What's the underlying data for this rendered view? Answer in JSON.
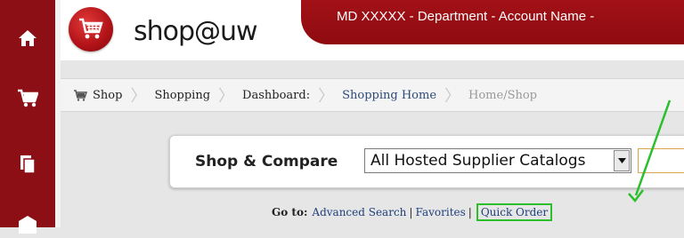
{
  "brand": {
    "logo_text": "shop@uw"
  },
  "account": {
    "banner_text": "MD XXXXX  -  Department  -  Account Name  -"
  },
  "rail": {
    "icons": [
      "home-icon",
      "cart-icon",
      "documents-icon",
      "inbox-icon"
    ]
  },
  "breadcrumb": {
    "items": [
      {
        "label": "Shop"
      },
      {
        "label": "Shopping"
      },
      {
        "label": "Dashboard:"
      },
      {
        "label": "Shopping Home"
      },
      {
        "label": "Home/Shop"
      }
    ]
  },
  "search": {
    "label": "Shop & Compare",
    "scope_selected": "All Hosted Supplier Catalogs"
  },
  "goto": {
    "label": "Go to:",
    "links": {
      "advanced_search": "Advanced Search",
      "favorites": "Favorites",
      "quick_order": "Quick Order"
    },
    "separator": "|"
  },
  "colors": {
    "rail": "#8b0f14",
    "banner": "#a21117",
    "link": "#1f3f7a",
    "annotation": "#2bbf2b"
  }
}
